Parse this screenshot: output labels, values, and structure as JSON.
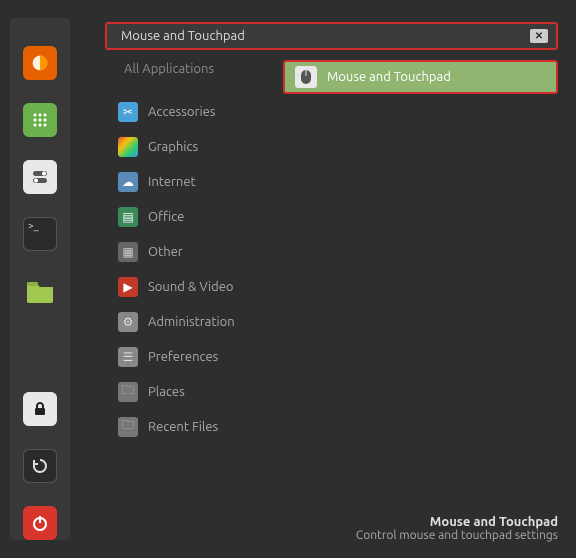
{
  "search": {
    "text": "Mouse and Touchpad"
  },
  "categories": {
    "header": "All Applications",
    "items": [
      {
        "label": "Accessories"
      },
      {
        "label": "Graphics"
      },
      {
        "label": "Internet"
      },
      {
        "label": "Office"
      },
      {
        "label": "Other"
      },
      {
        "label": "Sound & Video"
      },
      {
        "label": "Administration"
      },
      {
        "label": "Preferences"
      },
      {
        "label": "Places"
      },
      {
        "label": "Recent Files"
      }
    ]
  },
  "results": {
    "items": [
      {
        "label": "Mouse and Touchpad"
      }
    ]
  },
  "tooltip": {
    "title": "Mouse and Touchpad",
    "description": "Control mouse and touchpad settings"
  }
}
